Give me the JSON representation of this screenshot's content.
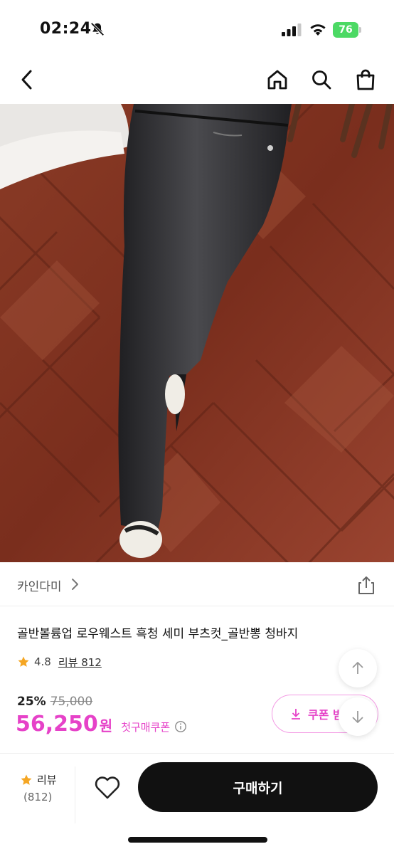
{
  "status_bar": {
    "time": "02:24",
    "battery": "76"
  },
  "icons": {
    "back": "chevron-left-icon",
    "home": "home-icon",
    "search": "search-icon",
    "cart": "shopping-bag-icon",
    "share": "share-icon",
    "star": "star-icon",
    "info": "info-icon",
    "download": "download-icon",
    "heart": "heart-icon",
    "scroll_up": "arrow-up-icon",
    "scroll_down": "arrow-down-icon"
  },
  "product": {
    "brand": "카인다미",
    "title": "골반볼륨업 로우웨스트 흑청 세미 부츠컷_골반뽕 청바지",
    "rating": "4.8",
    "review_label": "리뷰 812",
    "discount": "25%",
    "original_price": "75,000",
    "price": "56,250",
    "price_unit": "원",
    "first_coupon": "첫구매쿠폰"
  },
  "coupon_button": {
    "label": "쿠폰 받"
  },
  "bottom_bar": {
    "review_label": "리뷰",
    "review_count": "(812)",
    "buy_label": "구매하기"
  },
  "colors": {
    "accent_pink": "#e642c8",
    "coupon_border": "#f39be4",
    "star": "#f5a623",
    "buy_button": "#111111"
  }
}
